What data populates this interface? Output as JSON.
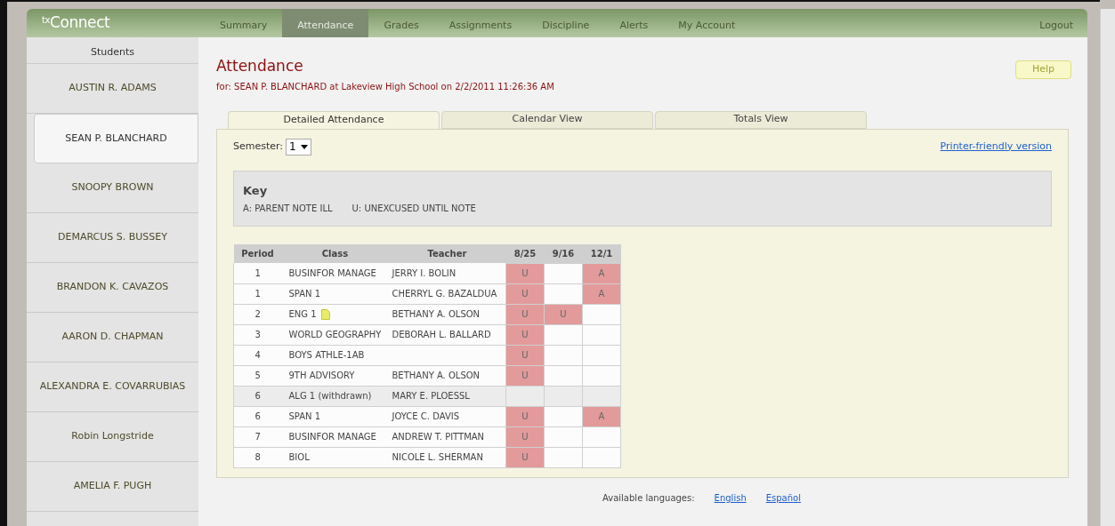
{
  "app": {
    "logo_prefix": "tx",
    "logo": "Connect"
  },
  "nav": [
    {
      "label": "Summary",
      "selected": false
    },
    {
      "label": "Attendance",
      "selected": true
    },
    {
      "label": "Grades",
      "selected": false
    },
    {
      "label": "Assignments",
      "selected": false
    },
    {
      "label": "Discipline",
      "selected": false
    },
    {
      "label": "Alerts",
      "selected": false
    },
    {
      "label": "My Account",
      "selected": false
    }
  ],
  "logout": "Logout",
  "sidebar": {
    "title": "Students",
    "items": [
      {
        "label": "AUSTIN R. ADAMS",
        "selected": false
      },
      {
        "label": "SEAN P. BLANCHARD",
        "selected": true
      },
      {
        "label": "SNOOPY BROWN",
        "selected": false
      },
      {
        "label": "DEMARCUS S. BUSSEY",
        "selected": false
      },
      {
        "label": "BRANDON K. CAVAZOS",
        "selected": false
      },
      {
        "label": "AARON D. CHAPMAN",
        "selected": false
      },
      {
        "label": "ALEXANDRA E. COVARRUBIAS",
        "selected": false
      },
      {
        "label": "Robin Longstride",
        "selected": false
      },
      {
        "label": "AMELIA F. PUGH",
        "selected": false
      }
    ]
  },
  "page": {
    "title": "Attendance",
    "subtitle": "for: SEAN P. BLANCHARD at Lakeview High School on 2/2/2011 11:26:36 AM",
    "help": "Help"
  },
  "tabs": [
    {
      "label": "Detailed Attendance",
      "selected": true
    },
    {
      "label": "Calendar View",
      "selected": false
    },
    {
      "label": "Totals View",
      "selected": false
    }
  ],
  "semester": {
    "label": "Semester:",
    "value": "1"
  },
  "printer_link": "Printer-friendly version",
  "key": {
    "title": "Key",
    "entries": [
      "A: PARENT NOTE ILL",
      "U: UNEXCUSED UNTIL NOTE"
    ]
  },
  "table": {
    "columns": [
      "Period",
      "Class",
      "Teacher",
      "8/25",
      "9/16",
      "12/1"
    ],
    "rows": [
      {
        "period": "1",
        "class": "BUSINFOR MANAGE",
        "teacher": "JERRY I. BOLIN",
        "note": false,
        "withdrawn": false,
        "codes": [
          {
            "marked": true,
            "code": "U"
          },
          {
            "marked": false
          },
          {
            "marked": true,
            "code": "A"
          }
        ]
      },
      {
        "period": "1",
        "class": "SPAN 1",
        "teacher": "CHERRYL G. BAZALDUA",
        "note": false,
        "withdrawn": false,
        "codes": [
          {
            "marked": true,
            "code": "U"
          },
          {
            "marked": false
          },
          {
            "marked": true,
            "code": "A"
          }
        ]
      },
      {
        "period": "2",
        "class": "ENG 1",
        "teacher": "BETHANY A. OLSON",
        "note": true,
        "withdrawn": false,
        "codes": [
          {
            "marked": true,
            "code": "U"
          },
          {
            "marked": true,
            "code": "U"
          },
          {
            "marked": false
          }
        ]
      },
      {
        "period": "3",
        "class": "WORLD GEOGRAPHY",
        "teacher": "DEBORAH L. BALLARD",
        "note": false,
        "withdrawn": false,
        "codes": [
          {
            "marked": true,
            "code": "U"
          },
          {
            "marked": false
          },
          {
            "marked": false
          }
        ]
      },
      {
        "period": "4",
        "class": "BOYS ATHLE-1AB",
        "note": false,
        "withdrawn": false,
        "codes": [
          {
            "marked": true,
            "code": "U"
          },
          {
            "marked": false
          },
          {
            "marked": false
          }
        ]
      },
      {
        "period": "5",
        "class": "9TH ADVISORY",
        "teacher": "BETHANY A. OLSON",
        "note": false,
        "withdrawn": false,
        "codes": [
          {
            "marked": true,
            "code": "U"
          },
          {
            "marked": false
          },
          {
            "marked": false
          }
        ]
      },
      {
        "period": "6",
        "class": "ALG 1 (withdrawn)",
        "teacher": "MARY E. PLOESSL",
        "note": false,
        "withdrawn": true,
        "codes": [
          {
            "marked": false
          },
          {
            "marked": false
          },
          {
            "marked": false
          }
        ]
      },
      {
        "period": "6",
        "class": "SPAN 1",
        "teacher": "JOYCE C. DAVIS",
        "note": false,
        "withdrawn": false,
        "codes": [
          {
            "marked": true,
            "code": "U"
          },
          {
            "marked": false
          },
          {
            "marked": true,
            "code": "A"
          }
        ]
      },
      {
        "period": "7",
        "class": "BUSINFOR MANAGE",
        "teacher": "ANDREW T. PITTMAN",
        "note": false,
        "withdrawn": false,
        "codes": [
          {
            "marked": true,
            "code": "U"
          },
          {
            "marked": false
          },
          {
            "marked": false
          }
        ]
      },
      {
        "period": "8",
        "class": "BIOL",
        "teacher": "NICOLE L. SHERMAN",
        "note": false,
        "withdrawn": false,
        "codes": [
          {
            "marked": true,
            "code": "U"
          },
          {
            "marked": false
          },
          {
            "marked": false
          }
        ]
      }
    ]
  },
  "footer": {
    "label": "Available languages:",
    "links": [
      "English",
      "Español"
    ]
  }
}
